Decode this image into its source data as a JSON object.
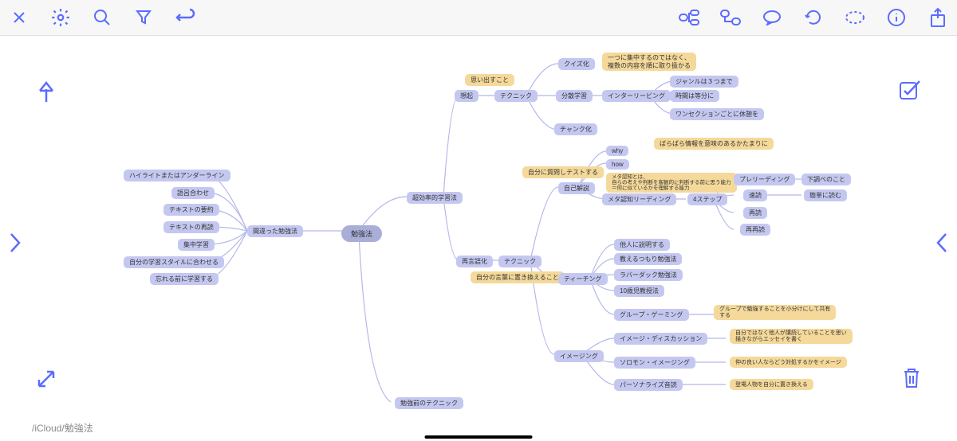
{
  "breadcrumb": "/iCloud/勉強法",
  "root": "勉強法",
  "nodes": {
    "wrong": "間違った勉強法",
    "w1": "ハイライトまたはアンダーライン",
    "w2": "語呂合わせ",
    "w3": "テキストの要約",
    "w4": "テキストの再読",
    "w5": "集中学習",
    "w6": "自分の学習スタイルに合わせる",
    "w7": "忘れる前に学習する",
    "pre": "勉強前のテクニック",
    "eff": "超効率的学習法",
    "recall": "想起",
    "rec_tech": "テクニック",
    "rec_note": "思い出すこと",
    "quiz": "クイズ化",
    "dist": "分散学習",
    "chunk": "チャンク化",
    "chunk_note": "ばらばら情報を意味のあるかたまりに",
    "inter": "インターリービング",
    "inter_note": "一つに集中するのではなく、\n複数の内容を順に取り扱かる",
    "i1": "ジャンルは３つまで",
    "i2": "時間は等分に",
    "i3": "ワンセクションごとに休憩を",
    "reword": "再言語化",
    "reword_tech": "テクニック",
    "reword_note": "自分の言葉に置き換えること",
    "self": "自己解説",
    "self_note": "自分に質問しテストする",
    "why": "why",
    "how": "how",
    "meta": "メタ認知リーディング",
    "meta_note": "メタ認知とは、\n自らの考えや判断を客観的に判断する前に思う能力\n＝何に似ているかを理解する能力",
    "steps": "4ステップ",
    "s1": "プレリーディング",
    "s1n": "下調べのこと",
    "s2": "速読",
    "s2n": "簡単に読む",
    "s3": "再読",
    "s4": "再再読",
    "teach": "ティーチング",
    "t1": "他人に説明する",
    "t2": "教えるつもり勉強法",
    "t3": "ラバーダック勉強法",
    "t4": "10歳児教授法",
    "gg": "グループ・ゲーミング",
    "gg_note": "グループで勉強することを小分けにして共有\nする",
    "img": "イメージング",
    "img1": "イメージ・ディスカッション",
    "img1n": "自分ではなく他人が講読していることを思い\n描きながらエッセイを書く",
    "img2": "ソロモン・イメージング",
    "img2n": "仲の良い人ならどう対処するかをイメージ",
    "img3": "パーソナライズ音読",
    "img3n": "登場人物を自分に置き換える"
  }
}
